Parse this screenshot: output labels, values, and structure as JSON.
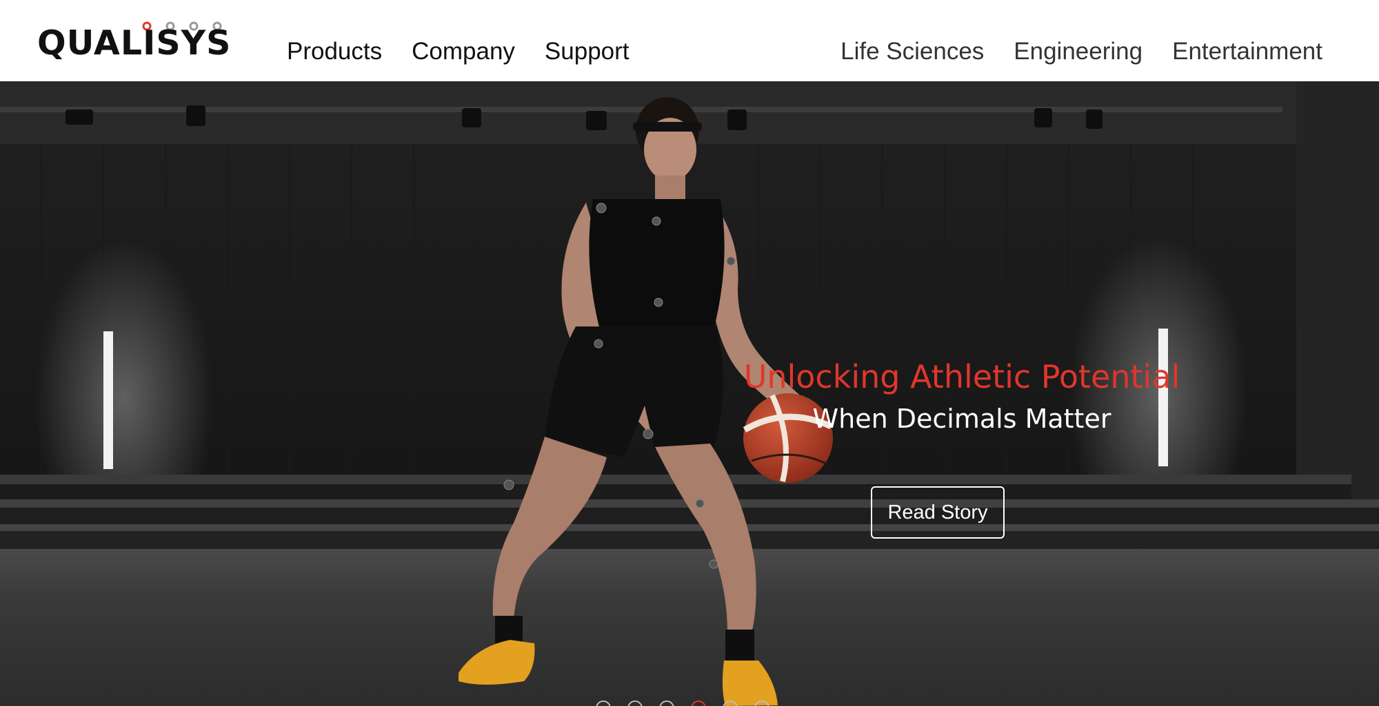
{
  "brand": {
    "name": "QUALISYS",
    "accent": "#e1362b"
  },
  "nav": {
    "primary": [
      "Products",
      "Company",
      "Support"
    ],
    "segments": [
      "Life Sciences",
      "Engineering",
      "Entertainment"
    ]
  },
  "hero": {
    "headline": "Unlocking Athletic Potential",
    "subline": "When Decimals Matter",
    "cta_label": "Read Story",
    "slide_count": 6,
    "active_slide": 4
  }
}
